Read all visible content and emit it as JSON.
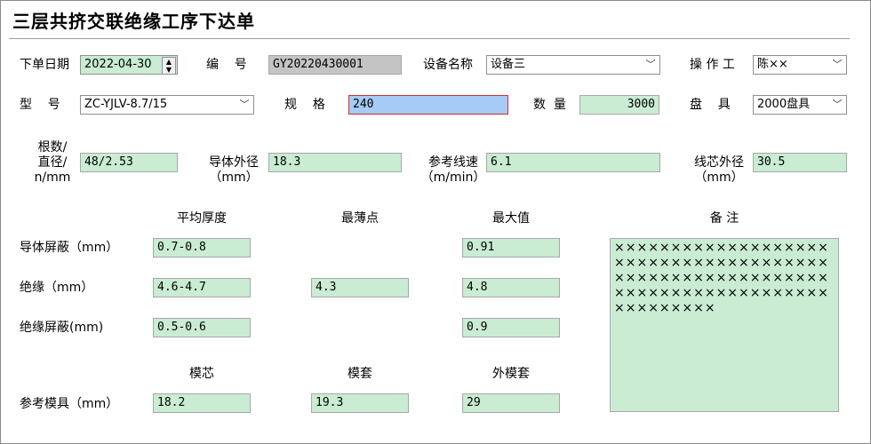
{
  "title": "三层共挤交联绝缘工序下达单",
  "row1": {
    "date_label": "下单日期",
    "date_value": "2022-04-30",
    "code_label": "编    号",
    "code_value": "GY20220430001",
    "equip_label": "设备名称",
    "equip_value": "设备三",
    "operator_label": "操 作 工",
    "operator_value": "陈××"
  },
  "row2": {
    "model_label": "型    号",
    "model_value": "ZC-YJLV-8.7/15",
    "spec_label": "规    格",
    "spec_value": "240",
    "qty_label": "数  量",
    "qty_value": "3000",
    "reel_label": "盘    具",
    "reel_value": "2000盘具"
  },
  "row3": {
    "count_label": "根数/\n直径/\nn/mm",
    "count_value": "48/2.53",
    "conductor_od_label": "导体外径\n（mm）",
    "conductor_od_value": "18.3",
    "speed_label": "参考线速\n（m/min）",
    "speed_value": "6.1",
    "core_od_label": "线芯外径\n（mm）",
    "core_od_value": "30.5"
  },
  "thickness": {
    "col_avg": "平均厚度",
    "col_min": "最薄点",
    "col_max": "最大值",
    "remark_label": "备 注",
    "rows": [
      {
        "label": "导体屏蔽（mm）",
        "avg": "0.7-0.8",
        "min": "",
        "max": "0.91"
      },
      {
        "label": "绝缘（mm）",
        "avg": "4.6-4.7",
        "min": "4.3",
        "max": "4.8"
      },
      {
        "label": "绝缘屏蔽(mm)",
        "avg": "0.5-0.6",
        "min": "",
        "max": "0.9"
      }
    ]
  },
  "mold": {
    "col_core": "模芯",
    "col_sleeve": "模套",
    "col_outer": "外模套",
    "row_label": "参考模具（mm）",
    "core": "18.2",
    "sleeve": "19.3",
    "outer": "29"
  },
  "remark": "×××××××××××××××××××××××××××××××××××××××××××××××××××××××××××××××××××××××××××××××××××××",
  "colors": {
    "field_green": "#c9ecd3",
    "field_blue": "#a6cbf4",
    "field_gray": "#c4c4c4",
    "focus_border": "#d03030"
  },
  "icons": {
    "dropdown": "chevron-down-icon",
    "spinner": "spin-updown-icon"
  }
}
